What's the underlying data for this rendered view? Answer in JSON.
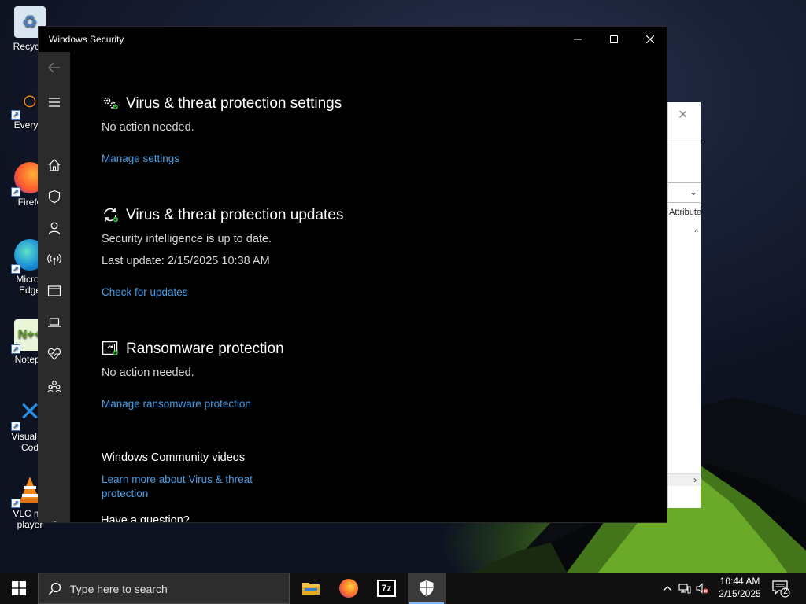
{
  "desktop": {
    "icons": [
      {
        "label": "Recycle",
        "icon": "recycle-bin-icon"
      },
      {
        "label": "Everyth",
        "icon": "everything-search-icon"
      },
      {
        "label": "Firefo",
        "icon": "firefox-icon"
      },
      {
        "label": "Micros\nEdge",
        "icon": "edge-icon"
      },
      {
        "label": "Notepa",
        "icon": "notepad-plus-plus-icon"
      },
      {
        "label": "Visual St\nCod",
        "icon": "vscode-icon"
      },
      {
        "label": "VLC me\nplayer",
        "icon": "vlc-icon"
      }
    ],
    "background_window": {
      "attr_text": "Attribute",
      "caret": "^"
    }
  },
  "window": {
    "title": "Windows Security",
    "colors": {
      "background": "#000000",
      "sidebar": "#2b2b2b",
      "link": "#4a9de6",
      "accent_green": "#3cb043"
    }
  },
  "sidebar": {
    "items": [
      {
        "name": "back",
        "icon": "back-arrow-icon"
      },
      {
        "name": "menu",
        "icon": "hamburger-menu-icon"
      },
      {
        "name": "home",
        "icon": "home-icon"
      },
      {
        "name": "virus-protection",
        "icon": "shield-icon"
      },
      {
        "name": "account-protection",
        "icon": "person-icon"
      },
      {
        "name": "firewall",
        "icon": "network-antenna-icon"
      },
      {
        "name": "app-browser-control",
        "icon": "browser-window-icon"
      },
      {
        "name": "device-security",
        "icon": "laptop-icon"
      },
      {
        "name": "device-performance",
        "icon": "heart-pulse-icon"
      },
      {
        "name": "family-options",
        "icon": "family-icon"
      },
      {
        "name": "settings",
        "icon": "gear-icon"
      }
    ]
  },
  "sections": {
    "settings": {
      "title": "Virus & threat protection settings",
      "status": "No action needed.",
      "link": "Manage settings"
    },
    "updates": {
      "title": "Virus & threat protection updates",
      "status": "Security intelligence is up to date.",
      "last_update": "Last update: 2/15/2025 10:38 AM",
      "link": "Check for updates"
    },
    "ransomware": {
      "title": "Ransomware protection",
      "status": "No action needed.",
      "link": "Manage ransomware protection"
    },
    "community": {
      "title": "Windows Community videos",
      "link_line1": "Learn more about Virus & threat",
      "link_line2": "protection"
    },
    "question": {
      "title": "Have a question?"
    }
  },
  "taskbar": {
    "search_placeholder": "Type here to search",
    "apps": [
      {
        "name": "file-explorer",
        "icon": "folder-icon"
      },
      {
        "name": "firefox",
        "icon": "firefox-icon"
      },
      {
        "name": "7zip",
        "icon": "7zip-icon",
        "label": "7z"
      },
      {
        "name": "windows-security",
        "icon": "shield-icon",
        "active": true
      }
    ],
    "clock_time": "10:44 AM",
    "clock_date": "2/15/2025",
    "notification_count": "2"
  }
}
